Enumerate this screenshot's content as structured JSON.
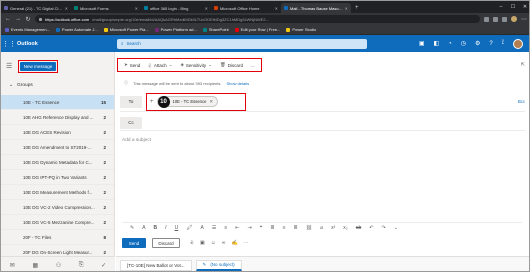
{
  "browser": {
    "tabs": [
      {
        "label": "General (21) - TC Digital Cine",
        "favicon_color": "#6264a7",
        "active": false
      },
      {
        "label": "Microsoft Forms",
        "favicon_color": "#008272",
        "active": false
      },
      {
        "label": "office 365 login - Bing",
        "favicon_color": "#00809d",
        "active": false
      },
      {
        "label": "Microsoft Office Home",
        "favicon_color": "#d83b01",
        "active": false
      },
      {
        "label": "Mail - Thomas Bause Mason - O",
        "favicon_color": "#0f6cbd",
        "active": true
      }
    ],
    "new_tab": "+",
    "url_host": "https://outlook.office.com",
    "url_path": "/mail/group/smpte.org/10e/email/id/AAQkAGRhMzdiMDk0LTUxODEtNDg3ZC1hMDg5LWNjNWE2...",
    "bookmarks": [
      {
        "label": "Events Managemen...",
        "color": "#5b5fc7"
      },
      {
        "label": "Power Automate J...",
        "color": "#0f6cbd"
      },
      {
        "label": "Microsoft Power Pla...",
        "color": "#f2c811"
      },
      {
        "label": "Power Platform ad...",
        "color": "#742774"
      },
      {
        "label": "SharePoint",
        "color": "#038387"
      },
      {
        "label": "Edit your Row | Free...",
        "color": "#e3000b"
      },
      {
        "label": "Power Studio",
        "color": "#f2c811"
      }
    ]
  },
  "outlook": {
    "brand": "Outlook",
    "search_placeholder": "Search"
  },
  "sidebar": {
    "new_message": "New message",
    "groups_label": "Groups",
    "groups": [
      {
        "name": "10E - TC Essence",
        "count": "15",
        "selected": true
      },
      {
        "name": "10E AHG Reference Display and ...",
        "count": "2",
        "selected": false
      },
      {
        "name": "10E DG ACES Revision",
        "count": "2",
        "selected": false
      },
      {
        "name": "10E DG Amendment to ST2019-...",
        "count": "2",
        "selected": false
      },
      {
        "name": "10E DG Dynamic Metadata for C...",
        "count": "2",
        "selected": false
      },
      {
        "name": "10E DG IPT-PQ in Two Variants",
        "count": "2",
        "selected": false
      },
      {
        "name": "10E DG Measurement Methods f...",
        "count": "2",
        "selected": false
      },
      {
        "name": "10E DG VC-2 Video Compression...",
        "count": "2",
        "selected": false
      },
      {
        "name": "10E DG VC-5 Mezzanine Compre...",
        "count": "2",
        "selected": false
      },
      {
        "name": "20F - TC Files",
        "count": "8",
        "selected": false
      },
      {
        "name": "20F DG On-Screen Light Measur...",
        "count": "2",
        "selected": false
      },
      {
        "name": "20F DG Unified Glossary",
        "count": "2",
        "selected": false
      }
    ]
  },
  "compose": {
    "toolbar": {
      "send": "Send",
      "attach": "Attach",
      "sensitivity": "Sensitivity",
      "discard": "Discard",
      "more": "..."
    },
    "info_text": "This message will be sent to about 393 recipients.",
    "info_link": "Show details",
    "to_label": "To",
    "recipient_number": "10",
    "recipient_chip": "10E - TC Essence",
    "bcc_label": "Bcc",
    "cc_label": "Cc",
    "subject_placeholder": "Add a subject",
    "send_button": "Send",
    "discard_button": "Discard"
  },
  "drafts": {
    "tab1": "[TC-10E] New Ballot or Vot...",
    "tab2": "(No subject)"
  }
}
